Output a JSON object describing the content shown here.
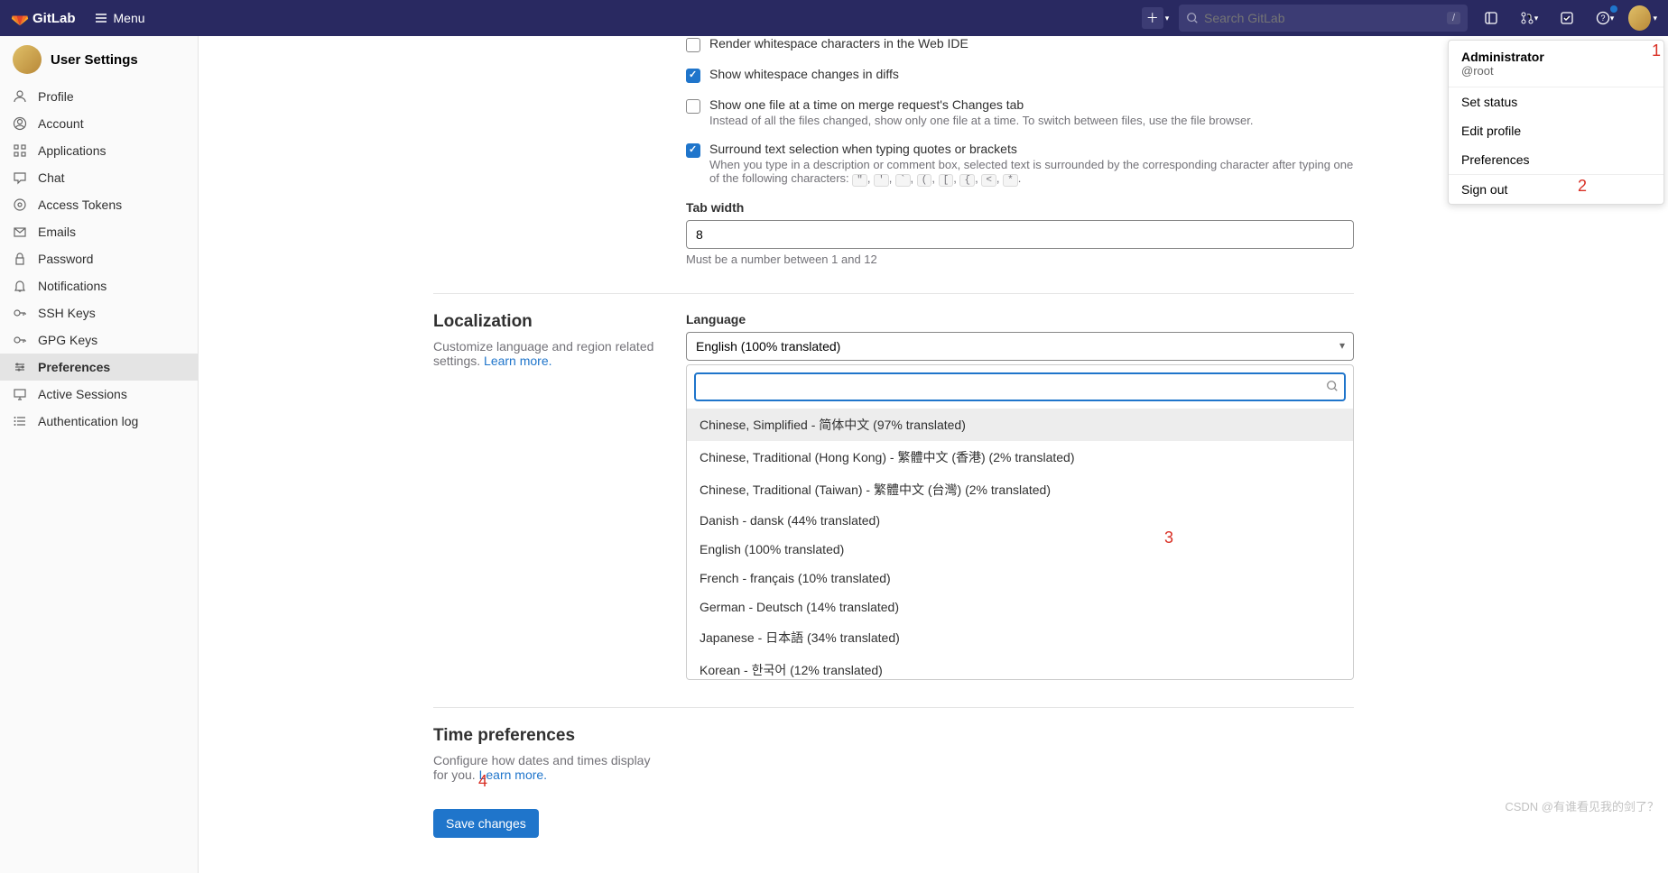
{
  "navbar": {
    "brand": "GitLab",
    "menu_label": "Menu",
    "search_placeholder": "Search GitLab",
    "search_kbd": "/"
  },
  "user_menu": {
    "name": "Administrator",
    "username": "@root",
    "items": [
      "Set status",
      "Edit profile",
      "Preferences",
      "Sign out"
    ]
  },
  "sidebar": {
    "title": "User Settings",
    "items": [
      {
        "label": "Profile",
        "icon": "profile"
      },
      {
        "label": "Account",
        "icon": "account"
      },
      {
        "label": "Applications",
        "icon": "apps"
      },
      {
        "label": "Chat",
        "icon": "chat"
      },
      {
        "label": "Access Tokens",
        "icon": "token"
      },
      {
        "label": "Emails",
        "icon": "email"
      },
      {
        "label": "Password",
        "icon": "lock"
      },
      {
        "label": "Notifications",
        "icon": "bell"
      },
      {
        "label": "SSH Keys",
        "icon": "key"
      },
      {
        "label": "GPG Keys",
        "icon": "key"
      },
      {
        "label": "Preferences",
        "icon": "prefs",
        "active": true
      },
      {
        "label": "Active Sessions",
        "icon": "monitor"
      },
      {
        "label": "Authentication log",
        "icon": "list"
      }
    ]
  },
  "behavior": {
    "render_whitespace": {
      "label": "Render whitespace characters in the Web IDE",
      "checked": false
    },
    "whitespace_diffs": {
      "label": "Show whitespace changes in diffs",
      "checked": true
    },
    "one_file": {
      "label": "Show one file at a time on merge request's Changes tab",
      "help": "Instead of all the files changed, show only one file at a time. To switch between files, use the file browser.",
      "checked": false
    },
    "surround": {
      "label": "Surround text selection when typing quotes or brackets",
      "help_pre": "When you type in a description or comment box, selected text is surrounded by the corresponding character after typing one of the following characters: ",
      "chars": [
        "\"",
        "'",
        "`",
        "(",
        "[",
        "{",
        "<",
        "*"
      ],
      "checked": true
    },
    "tab_width_label": "Tab width",
    "tab_width_value": "8",
    "tab_width_help": "Must be a number between 1 and 12"
  },
  "localization": {
    "title": "Localization",
    "desc": "Customize language and region related settings. ",
    "learn_more": "Learn more.",
    "language_label": "Language",
    "selected": "English (100% translated)",
    "search_value": "",
    "options": [
      "Chinese, Simplified - 简体中文 (97% translated)",
      "Chinese, Traditional (Hong Kong) - 繁體中文 (香港) (2% translated)",
      "Chinese, Traditional (Taiwan) - 繁體中文 (台灣) (2% translated)",
      "Danish - dansk (44% translated)",
      "English (100% translated)",
      "French - français (10% translated)",
      "German - Deutsch (14% translated)",
      "Japanese - 日本語 (34% translated)",
      "Korean - 한국어 (12% translated)"
    ]
  },
  "time": {
    "title": "Time preferences",
    "desc": "Configure how dates and times display for you. ",
    "learn_more": "Learn more."
  },
  "save_button": "Save changes",
  "annotations": {
    "a1": "1",
    "a2": "2",
    "a3": "3",
    "a4": "4"
  },
  "watermark": "CSDN @有谁看见我的剑了？"
}
